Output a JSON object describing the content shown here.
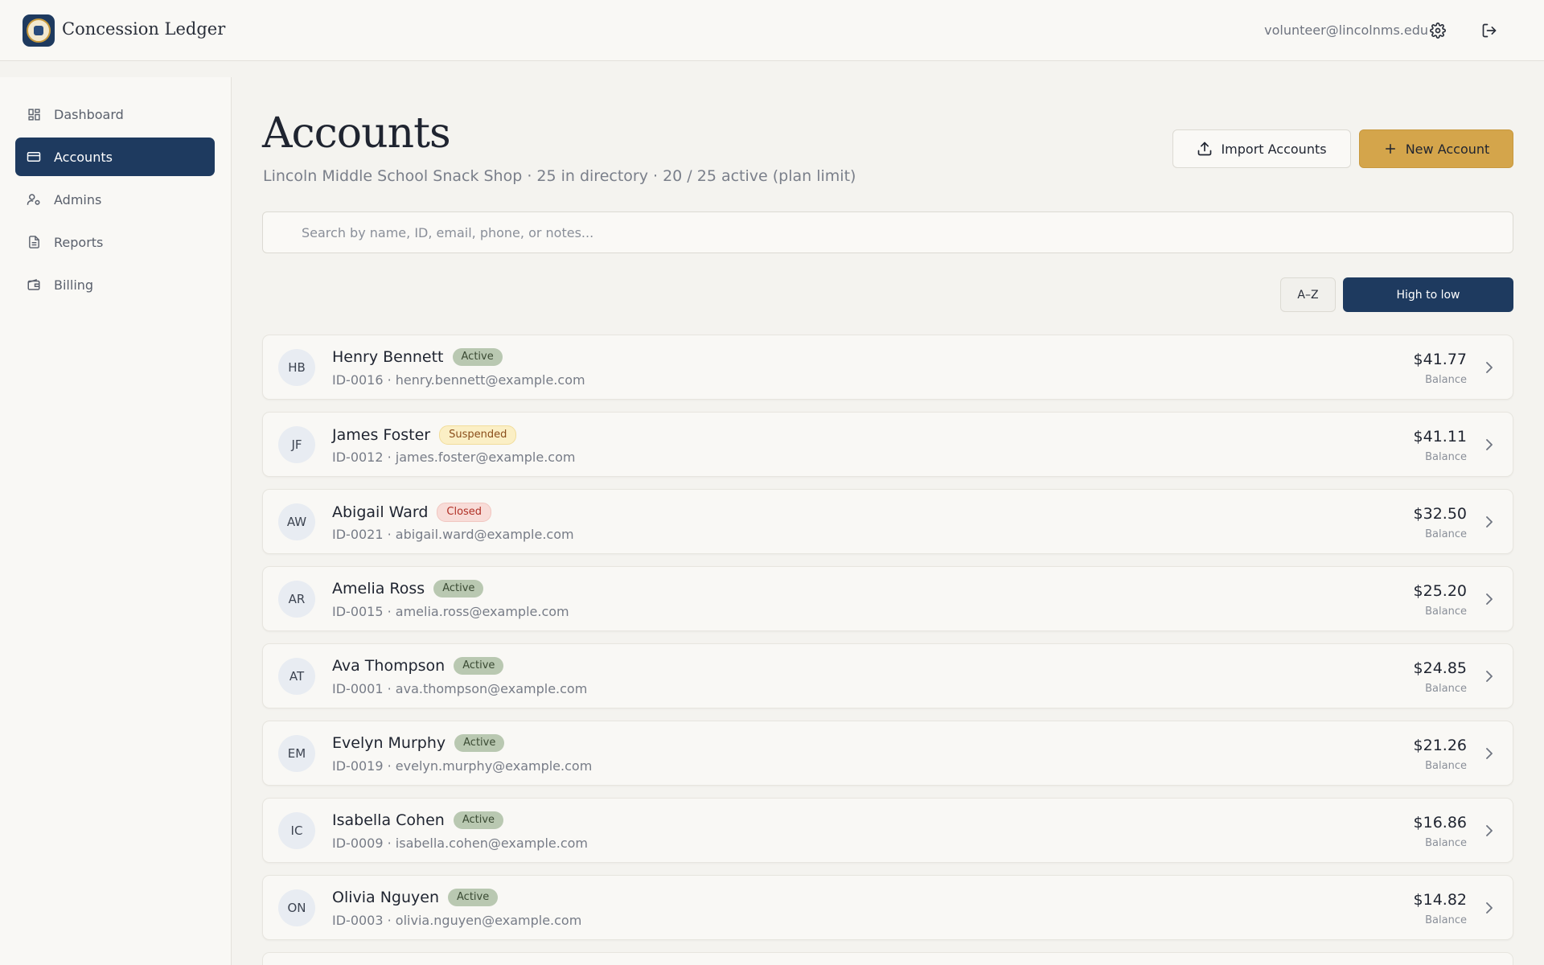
{
  "app": {
    "brand": "Concession Ledger",
    "user_email": "volunteer@lincolnms.edu"
  },
  "colors": {
    "primary_navy": "#1e3a5f",
    "accent_gold": "#d4a54b",
    "background": "#f4f3ef"
  },
  "icons": {
    "settings": "gear-icon",
    "logout": "logout-icon"
  },
  "sidebar": {
    "items": [
      {
        "label": "Dashboard",
        "icon": "grid-icon",
        "active": false
      },
      {
        "label": "Accounts",
        "icon": "card-icon",
        "active": true
      },
      {
        "label": "Admins",
        "icon": "user-gear-icon",
        "active": false
      },
      {
        "label": "Reports",
        "icon": "document-icon",
        "active": false
      },
      {
        "label": "Billing",
        "icon": "wallet-icon",
        "active": false
      }
    ]
  },
  "main": {
    "title": "Accounts",
    "subtitle": "Lincoln Middle School Snack Shop · 25 in directory · 20 / 25 active (plan limit)",
    "import_label": "Import Accounts",
    "new_label": "New Account",
    "search_placeholder": "Search by name, ID, email, phone, or notes...",
    "sort_az_label": "A–Z",
    "sort_hl_label": "High to low",
    "balance_label": "Balance"
  },
  "accounts": [
    {
      "initials": "HB",
      "name": "Henry Bennett",
      "status": "Active",
      "meta": "ID-0016 · henry.bennett@example.com",
      "balance": "$41.77"
    },
    {
      "initials": "JF",
      "name": "James Foster",
      "status": "Suspended",
      "meta": "ID-0012 · james.foster@example.com",
      "balance": "$41.11"
    },
    {
      "initials": "AW",
      "name": "Abigail Ward",
      "status": "Closed",
      "meta": "ID-0021 · abigail.ward@example.com",
      "balance": "$32.50"
    },
    {
      "initials": "AR",
      "name": "Amelia Ross",
      "status": "Active",
      "meta": "ID-0015 · amelia.ross@example.com",
      "balance": "$25.20"
    },
    {
      "initials": "AT",
      "name": "Ava Thompson",
      "status": "Active",
      "meta": "ID-0001 · ava.thompson@example.com",
      "balance": "$24.85"
    },
    {
      "initials": "EM",
      "name": "Evelyn Murphy",
      "status": "Active",
      "meta": "ID-0019 · evelyn.murphy@example.com",
      "balance": "$21.26"
    },
    {
      "initials": "IC",
      "name": "Isabella Cohen",
      "status": "Active",
      "meta": "ID-0009 · isabella.cohen@example.com",
      "balance": "$16.86"
    },
    {
      "initials": "ON",
      "name": "Olivia Nguyen",
      "status": "Active",
      "meta": "ID-0003 · olivia.nguyen@example.com",
      "balance": "$14.82"
    }
  ]
}
